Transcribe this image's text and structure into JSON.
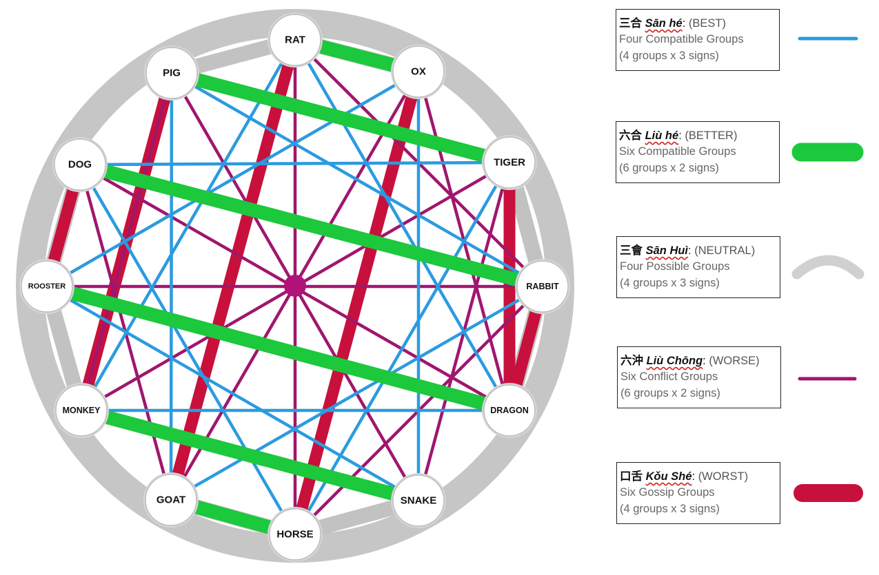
{
  "signs": [
    "RAT",
    "OX",
    "TIGER",
    "RABBIT",
    "DRAGON",
    "SNAKE",
    "HORSE",
    "GOAT",
    "MONKEY",
    "ROOSTER",
    "DOG",
    "PIG"
  ],
  "relations": {
    "san_he": [
      [
        "RAT",
        "DRAGON"
      ],
      [
        "DRAGON",
        "MONKEY"
      ],
      [
        "MONKEY",
        "RAT"
      ],
      [
        "OX",
        "SNAKE"
      ],
      [
        "SNAKE",
        "ROOSTER"
      ],
      [
        "ROOSTER",
        "OX"
      ],
      [
        "TIGER",
        "HORSE"
      ],
      [
        "HORSE",
        "DOG"
      ],
      [
        "DOG",
        "TIGER"
      ],
      [
        "RABBIT",
        "GOAT"
      ],
      [
        "GOAT",
        "PIG"
      ],
      [
        "PIG",
        "RABBIT"
      ]
    ],
    "liu_he": [
      [
        "RAT",
        "OX"
      ],
      [
        "PIG",
        "TIGER"
      ],
      [
        "DOG",
        "RABBIT"
      ],
      [
        "ROOSTER",
        "DRAGON"
      ],
      [
        "MONKEY",
        "SNAKE"
      ],
      [
        "GOAT",
        "HORSE"
      ]
    ],
    "liu_chong": [
      [
        "RAT",
        "HORSE"
      ],
      [
        "OX",
        "GOAT"
      ],
      [
        "TIGER",
        "MONKEY"
      ],
      [
        "RABBIT",
        "ROOSTER"
      ],
      [
        "DRAGON",
        "DOG"
      ],
      [
        "SNAKE",
        "PIG"
      ],
      [
        "RAT",
        "RABBIT"
      ],
      [
        "HORSE",
        "RABBIT"
      ],
      [
        "PIG",
        "MONKEY"
      ],
      [
        "TIGER",
        "SNAKE"
      ],
      [
        "GOAT",
        "DOG"
      ],
      [
        "OX",
        "DRAGON"
      ]
    ],
    "kou_she": [
      [
        "RAT",
        "GOAT"
      ],
      [
        "OX",
        "HORSE"
      ],
      [
        "TIGER",
        "DRAGON"
      ],
      [
        "RABBIT",
        "DRAGON"
      ],
      [
        "SNAKE",
        "TIGER"
      ],
      [
        "PIG",
        "MONKEY"
      ],
      [
        "DOG",
        "ROOSTER"
      ]
    ]
  },
  "legend": [
    {
      "zh": "三合",
      "pinyin": "Sān hé",
      "level": "(BEST)",
      "line1": "Four Compatible Groups",
      "line2": "(4 groups x 3 signs)",
      "color": "#2b9be0",
      "style": "thin"
    },
    {
      "zh": "六合",
      "pinyin": "Liù hé",
      "level": "(BETTER)",
      "line1": "Six Compatible Groups",
      "line2": "(6 groups x 2 signs)",
      "color": "#1cc83c",
      "style": "thick"
    },
    {
      "zh": "三會",
      "pinyin": "Sān Huì",
      "level": "(NEUTRAL)",
      "line1": "Four Possible Groups",
      "line2": "(4 groups x 3 signs)",
      "color": "#c0c0c0",
      "style": "arc"
    },
    {
      "zh": "六沖",
      "pinyin": "Liù Chōng",
      "level": "(WORSE)",
      "line1": "Six Conflict Groups",
      "line2": "(6 groups x 2 signs)",
      "color": "#a0166e",
      "style": "thin"
    },
    {
      "zh": "口舌",
      "pinyin": "Kǒu Shé",
      "level": "(WORST)",
      "line1": "Six Gossip Groups",
      "line2": "(4 groups x 3 signs)",
      "color": "#c8103c",
      "style": "thick"
    }
  ]
}
